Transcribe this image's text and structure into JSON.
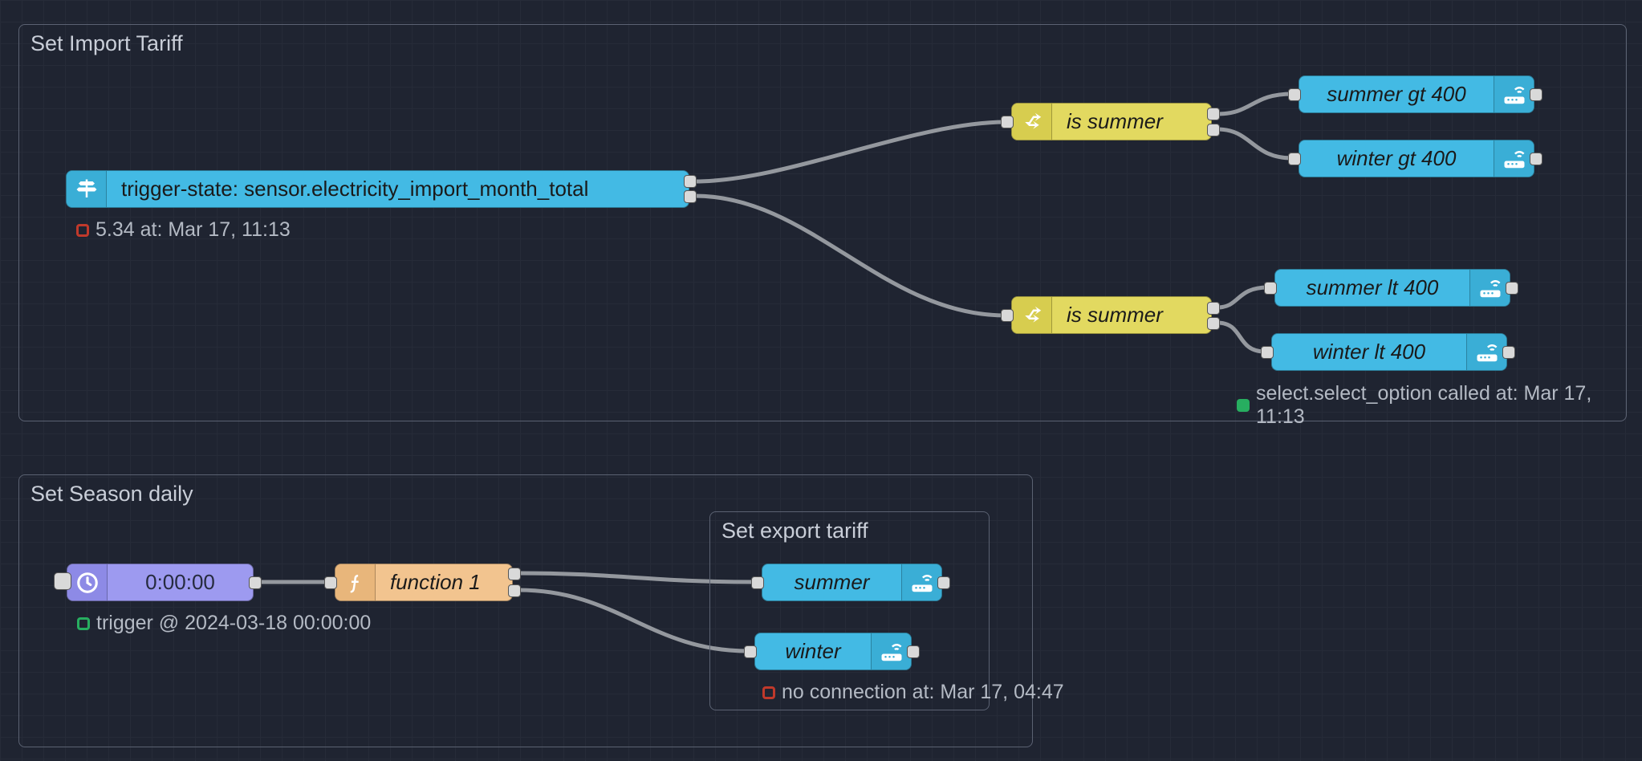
{
  "groups": {
    "g1": {
      "label": "Set Import Tariff"
    },
    "g2": {
      "label": "Set Season daily"
    },
    "g3": {
      "label": "Set export tariff"
    }
  },
  "nodes": {
    "trigger": {
      "label": "trigger-state: sensor.electricity_import_month_total"
    },
    "switch1": {
      "label": "is summer"
    },
    "switch2": {
      "label": "is summer"
    },
    "summer_gt": {
      "label": "summer gt 400"
    },
    "winter_gt": {
      "label": "winter gt 400"
    },
    "summer_lt": {
      "label": "summer lt 400"
    },
    "winter_lt": {
      "label": "winter lt 400"
    },
    "inject": {
      "label": "0:00:00"
    },
    "func": {
      "label": "function 1"
    },
    "summer": {
      "label": "summer"
    },
    "winter": {
      "label": "winter"
    }
  },
  "status": {
    "trigger": "5.34 at: Mar 17, 11:13",
    "select": "select.select_option called at: Mar 17, 11:13",
    "inject": "trigger @ 2024-03-18 00:00:00",
    "noconn": "no connection at: Mar 17, 04:47"
  }
}
